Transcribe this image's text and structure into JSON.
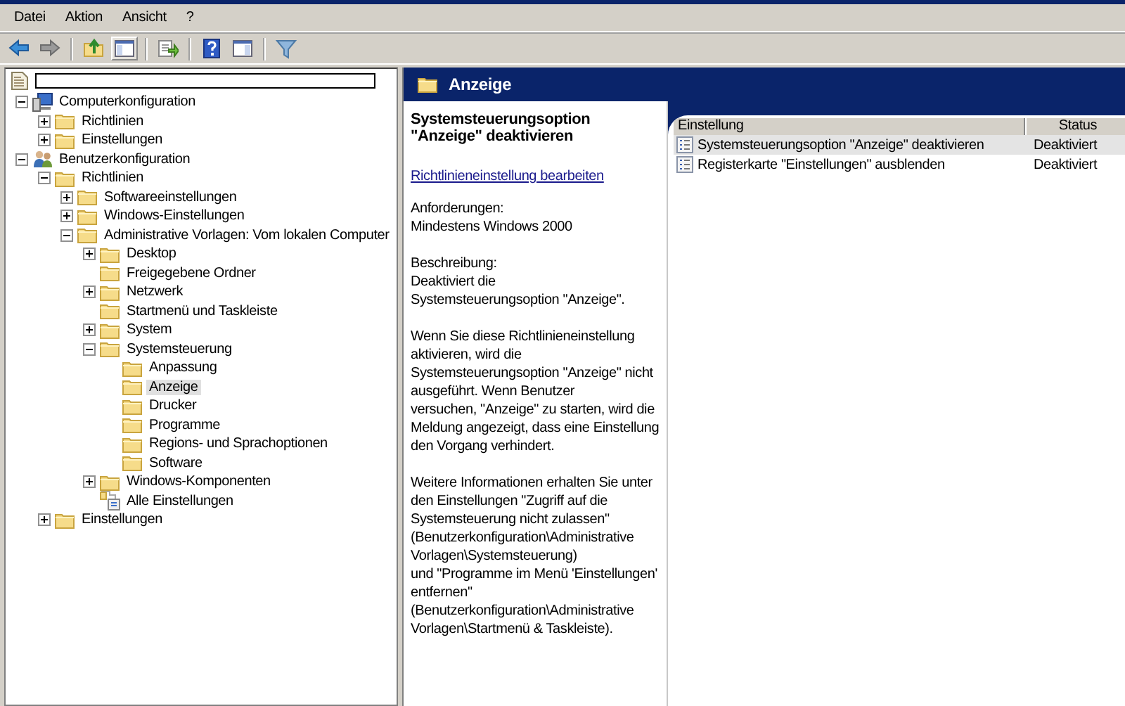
{
  "menu": [
    "Datei",
    "Aktion",
    "Ansicht",
    "?"
  ],
  "tree": [
    {
      "label": "Computerkonfiguration",
      "kind": "computer",
      "expanded": true,
      "selected": false,
      "children": [
        {
          "label": "Richtlinien",
          "kind": "folder",
          "expanded": false,
          "selected": false
        },
        {
          "label": "Einstellungen",
          "kind": "folder",
          "expanded": false,
          "selected": false
        }
      ]
    },
    {
      "label": "Benutzerkonfiguration",
      "kind": "user",
      "expanded": true,
      "selected": false,
      "children": [
        {
          "label": "Richtlinien",
          "kind": "folder",
          "expanded": true,
          "selected": false,
          "children": [
            {
              "label": "Softwareeinstellungen",
              "kind": "folder",
              "expanded": false,
              "selected": false
            },
            {
              "label": "Windows-Einstellungen",
              "kind": "folder",
              "expanded": false,
              "selected": false
            },
            {
              "label": "Administrative Vorlagen: Vom lokalen Computer",
              "kind": "folder",
              "expanded": true,
              "selected": false,
              "children": [
                {
                  "label": "Desktop",
                  "kind": "folder",
                  "expanded": false,
                  "selected": false
                },
                {
                  "label": "Freigegebene Ordner",
                  "kind": "folder",
                  "selected": false
                },
                {
                  "label": "Netzwerk",
                  "kind": "folder",
                  "expanded": false,
                  "selected": false
                },
                {
                  "label": "Startmenü und Taskleiste",
                  "kind": "folder",
                  "selected": false
                },
                {
                  "label": "System",
                  "kind": "folder",
                  "expanded": false,
                  "selected": false
                },
                {
                  "label": "Systemsteuerung",
                  "kind": "folder",
                  "expanded": true,
                  "selected": false,
                  "children": [
                    {
                      "label": "Anpassung",
                      "kind": "folder",
                      "selected": false
                    },
                    {
                      "label": "Anzeige",
                      "kind": "folder",
                      "selected": true
                    },
                    {
                      "label": "Drucker",
                      "kind": "folder",
                      "selected": false
                    },
                    {
                      "label": "Programme",
                      "kind": "folder",
                      "selected": false
                    },
                    {
                      "label": "Regions- und Sprachoptionen",
                      "kind": "folder",
                      "selected": false
                    },
                    {
                      "label": "Software",
                      "kind": "folder",
                      "selected": false
                    }
                  ]
                },
                {
                  "label": "Windows-Komponenten",
                  "kind": "folder",
                  "expanded": false,
                  "selected": false
                },
                {
                  "label": "Alle Einstellungen",
                  "kind": "settings",
                  "selected": false
                }
              ]
            }
          ]
        },
        {
          "label": "Einstellungen",
          "kind": "folder",
          "expanded": false,
          "selected": false
        }
      ]
    }
  ],
  "panel": {
    "title": "Anzeige"
  },
  "detail": {
    "title": "Systemsteuerungsoption \"Anzeige\" deaktivieren",
    "link": "Richtlinieneinstellung bearbeiten",
    "paragraphs": [
      "Anforderungen:\nMindestens Windows 2000",
      "Beschreibung:\nDeaktiviert die\nSystemsteuerungsoption \"Anzeige\".",
      "Wenn Sie diese Richtlinieneinstellung\naktivieren, wird die\nSystemsteuerungsoption \"Anzeige\" nicht\nausgeführt. Wenn Benutzer\nversuchen, \"Anzeige\" zu starten, wird die\nMeldung angezeigt, dass eine Einstellung\nden Vorgang verhindert.",
      "Weitere Informationen erhalten Sie unter\nden Einstellungen \"Zugriff auf die\nSystemsteuerung nicht zulassen\"\n(Benutzerkonfiguration\\Administrative\nVorlagen\\Systemsteuerung)\nund \"Programme im Menü 'Einstellungen'\nentfernen\"\n(Benutzerkonfiguration\\Administrative\nVorlagen\\Startmenü & Taskleiste)."
    ]
  },
  "table": {
    "columns": [
      "Einstellung",
      "Status"
    ],
    "rows": [
      {
        "name": "Systemsteuerungsoption \"Anzeige\" deaktivieren",
        "status": "Deaktiviert",
        "selected": true
      },
      {
        "name": "Registerkarte \"Einstellungen\" ausblenden",
        "status": "Deaktiviert",
        "selected": false
      }
    ]
  }
}
